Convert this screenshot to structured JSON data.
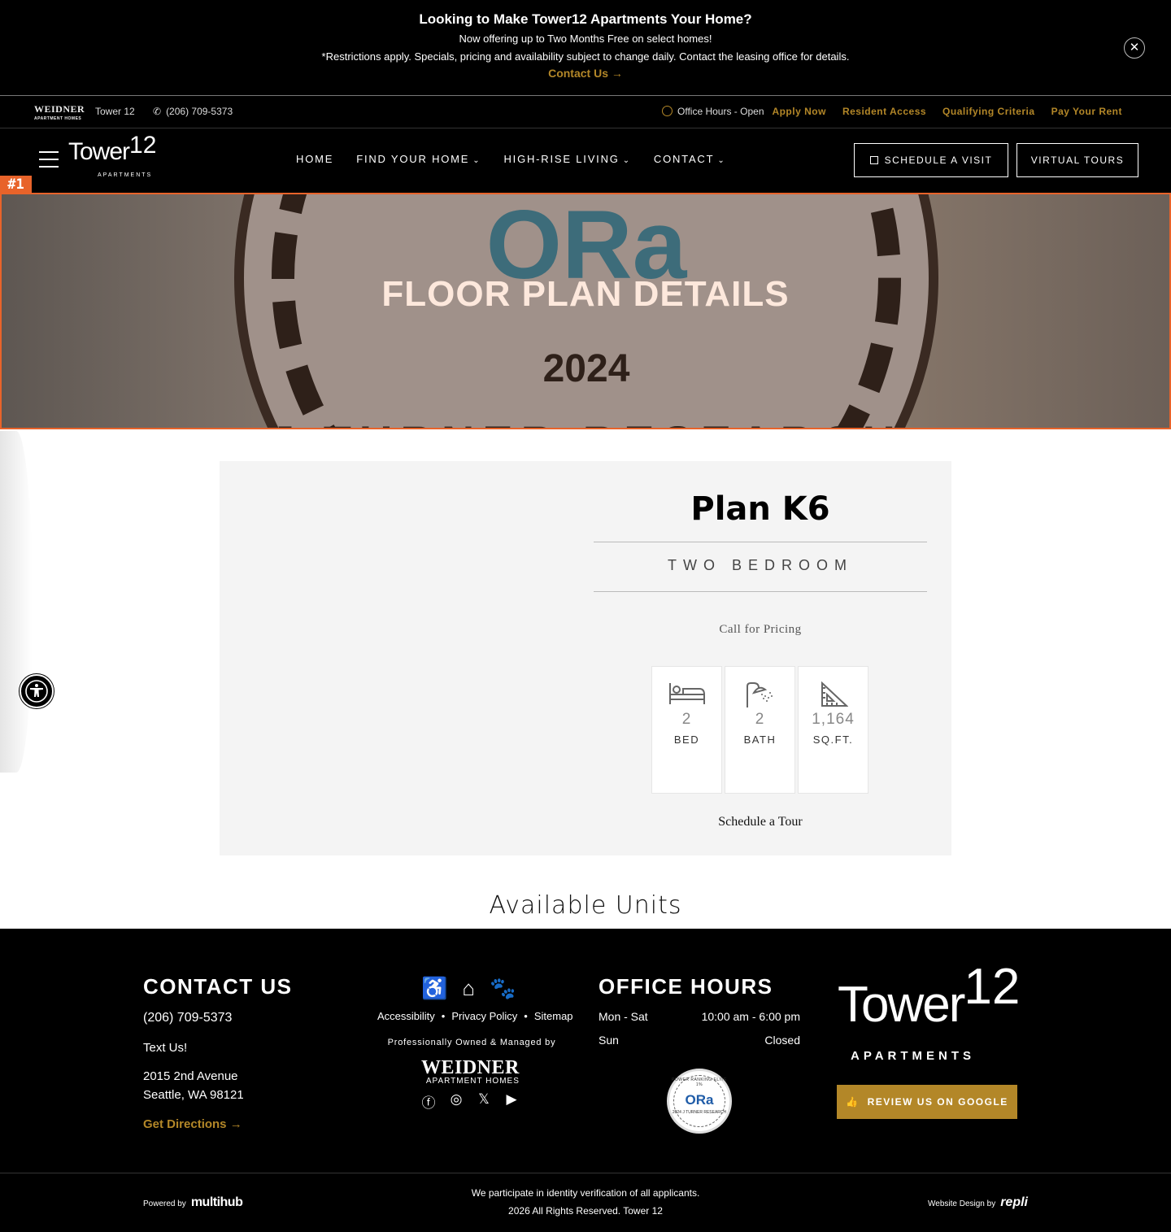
{
  "promo": {
    "title": "Looking to Make Tower12 Apartments Your Home?",
    "line1": "Now offering up to Two Months Free on select homes!",
    "line2": "*Restrictions apply. Specials, pricing and availability subject to change daily. Contact the leasing office for details.",
    "cta": "Contact Us →",
    "close": "✕"
  },
  "utility": {
    "brand": "WEIDNER",
    "brand_sub": "APARTMENT HOMES",
    "community": "Tower 12",
    "phone": "(206) 709-5373",
    "office_hours": "Office Hours - Open",
    "links": [
      "Apply Now",
      "Resident Access",
      "Qualifying Criteria",
      "Pay Your Rent"
    ]
  },
  "nav": {
    "logo_text": "Tower",
    "logo_num": "12",
    "logo_sub": "APARTMENTS",
    "items": [
      "HOME",
      "FIND YOUR HOME",
      "HIGH-RISE LIVING",
      "CONTACT"
    ],
    "schedule_visit": "SCHEDULE A VISIT",
    "virtual_tours": "VIRTUAL TOURS"
  },
  "hero": {
    "title": "FLOOR PLAN DETAILS",
    "badge_text": "ORa",
    "badge_year": "2024",
    "badge_arc": "J TURNER RESEARCH",
    "tag": "#1"
  },
  "plan": {
    "name": "Plan K6",
    "type": "TWO BEDROOM",
    "pricing": "Call for Pricing",
    "stats": [
      {
        "value": "2",
        "label": "BED",
        "icon": "bed-icon"
      },
      {
        "value": "2",
        "label": "BATH",
        "icon": "shower-icon"
      },
      {
        "value": "1,164",
        "label": "SQ.FT.",
        "icon": "ruler-triangle-icon"
      }
    ],
    "tour_link": "Schedule a Tour"
  },
  "available_units": "Available Units",
  "footer": {
    "contact_heading": "CONTACT US",
    "phone": "(206) 709-5373",
    "text_us": "Text Us!",
    "address1": "2015 2nd Avenue",
    "address2": "Seattle, WA 98121",
    "directions": "Get Directions →",
    "legal_links": [
      "Accessibility",
      "Privacy Policy",
      "Sitemap"
    ],
    "managed_by": "Professionally Owned & Managed by",
    "weidner": "WEIDNER",
    "weidner_sub": "APARTMENT HOMES",
    "hours_heading": "OFFICE HOURS",
    "hours": [
      {
        "day": "Mon - Sat",
        "time": "10:00 am - 6:00 pm"
      },
      {
        "day": "Sun",
        "time": "Closed"
      }
    ],
    "ora_top": "POWER RANKING ELITE 1%",
    "ora_mid": "ORa",
    "ora_bottom": "2024 J TURNER RESEARCH",
    "logo_text": "Tower",
    "logo_num": "12",
    "logo_sub": "APARTMENTS",
    "review": "REVIEW US ON GOOGLE",
    "powered_by": "Powered by",
    "powered_brand": "multihub",
    "verification": "We participate in identity verification of all applicants.",
    "copyright": "2026 All Rights Reserved. Tower 12",
    "design_by": "Website Design by",
    "design_brand": "repli"
  }
}
